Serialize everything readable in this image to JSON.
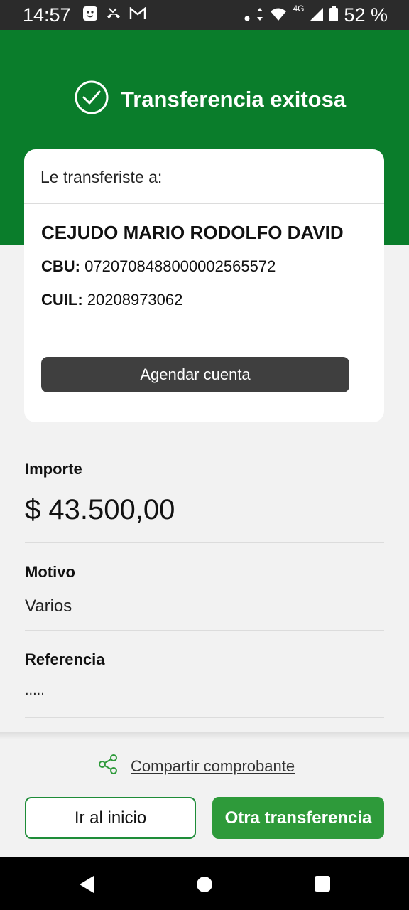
{
  "status_bar": {
    "time": "14:57",
    "network": "4G",
    "battery": "52 %",
    "left_icons": [
      "face-scan-icon",
      "missed-call-icon",
      "gmail-icon"
    ],
    "right_icons": [
      "dot-icon",
      "data-arrows-icon",
      "wifi-icon",
      "signal-icon",
      "battery-icon"
    ]
  },
  "header": {
    "title": "Transferencia exitosa",
    "icon": "check-circle-icon",
    "color": "#0a7d2b"
  },
  "recipient_card": {
    "heading": "Le transferiste a:",
    "name": "CEJUDO MARIO RODOLFO DAVID",
    "cbu_label": "CBU:",
    "cbu_value": "0720708488000002565572",
    "cuil_label": "CUIL:",
    "cuil_value": "20208973062",
    "button_label": "Agendar cuenta"
  },
  "details": {
    "amount_label": "Importe",
    "amount_value": "$ 43.500,00",
    "reason_label": "Motivo",
    "reason_value": "Varios",
    "reference_label": "Referencia",
    "reference_value": "....."
  },
  "actions": {
    "share_label": "Compartir comprobante",
    "share_icon": "share-icon",
    "home_label": "Ir al inicio",
    "new_transfer_label": "Otra transferencia",
    "accent": "#2e9a3a"
  },
  "nav_bar": {
    "icons": [
      "back-icon",
      "home-icon",
      "recents-icon"
    ]
  }
}
